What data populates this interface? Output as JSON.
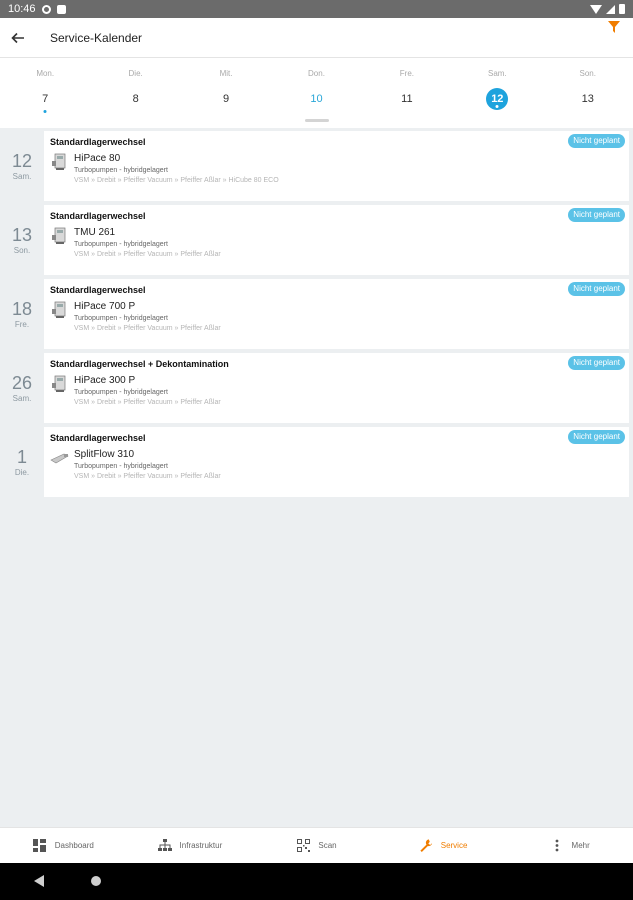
{
  "status_bar": {
    "time": "10:46"
  },
  "app_bar": {
    "title": "Service-Kalender"
  },
  "week": [
    {
      "name": "Mon.",
      "num": "7",
      "state": "today-marker"
    },
    {
      "name": "Die.",
      "num": "8",
      "state": ""
    },
    {
      "name": "Mit.",
      "num": "9",
      "state": ""
    },
    {
      "name": "Don.",
      "num": "10",
      "state": "today"
    },
    {
      "name": "Fre.",
      "num": "11",
      "state": ""
    },
    {
      "name": "Sam.",
      "num": "12",
      "state": "selected"
    },
    {
      "name": "Son.",
      "num": "13",
      "state": ""
    }
  ],
  "events": [
    {
      "date_num": "12",
      "date_day": "Sam.",
      "title": "Standardlagerwechsel",
      "badge": "Nicht geplant",
      "device": "HiPace 80",
      "category": "Turbopumpen - hybridgelagert",
      "path": "VSM » Drebit » Pfeiffer Vacuum » Pfeiffer Aßlar » HiCube 80 ECO"
    },
    {
      "date_num": "13",
      "date_day": "Son.",
      "title": "Standardlagerwechsel",
      "badge": "Nicht geplant",
      "device": "TMU 261",
      "category": "Turbopumpen - hybridgelagert",
      "path": "VSM » Drebit » Pfeiffer Vacuum » Pfeiffer Aßlar"
    },
    {
      "date_num": "18",
      "date_day": "Fre.",
      "title": "Standardlagerwechsel",
      "badge": "Nicht geplant",
      "device": "HiPace 700 P",
      "category": "Turbopumpen - hybridgelagert",
      "path": "VSM » Drebit » Pfeiffer Vacuum » Pfeiffer Aßlar"
    },
    {
      "date_num": "26",
      "date_day": "Sam.",
      "title": "Standardlagerwechsel + Dekontamination",
      "badge": "Nicht geplant",
      "device": "HiPace 300 P",
      "category": "Turbopumpen - hybridgelagert",
      "path": "VSM » Drebit » Pfeiffer Vacuum » Pfeiffer Aßlar"
    },
    {
      "date_num": "1",
      "date_day": "Die.",
      "title": "Standardlagerwechsel",
      "badge": "Nicht geplant",
      "device": "SplitFlow 310",
      "category": "Turbopumpen - hybridgelagert",
      "path": "VSM » Drebit » Pfeiffer Vacuum » Pfeiffer Aßlar"
    }
  ],
  "bottom_nav": [
    {
      "label": "Dashboard",
      "icon": "dashboard-icon",
      "active": false
    },
    {
      "label": "Infrastruktur",
      "icon": "hierarchy-icon",
      "active": false
    },
    {
      "label": "Scan",
      "icon": "qr-scan-icon",
      "active": false
    },
    {
      "label": "Service",
      "icon": "wrench-icon",
      "active": true
    },
    {
      "label": "Mehr",
      "icon": "more-vertical-icon",
      "active": false
    }
  ],
  "colors": {
    "accent_orange": "#f07d00",
    "accent_blue": "#1ea3dd",
    "badge_blue": "#5bc2e7"
  }
}
